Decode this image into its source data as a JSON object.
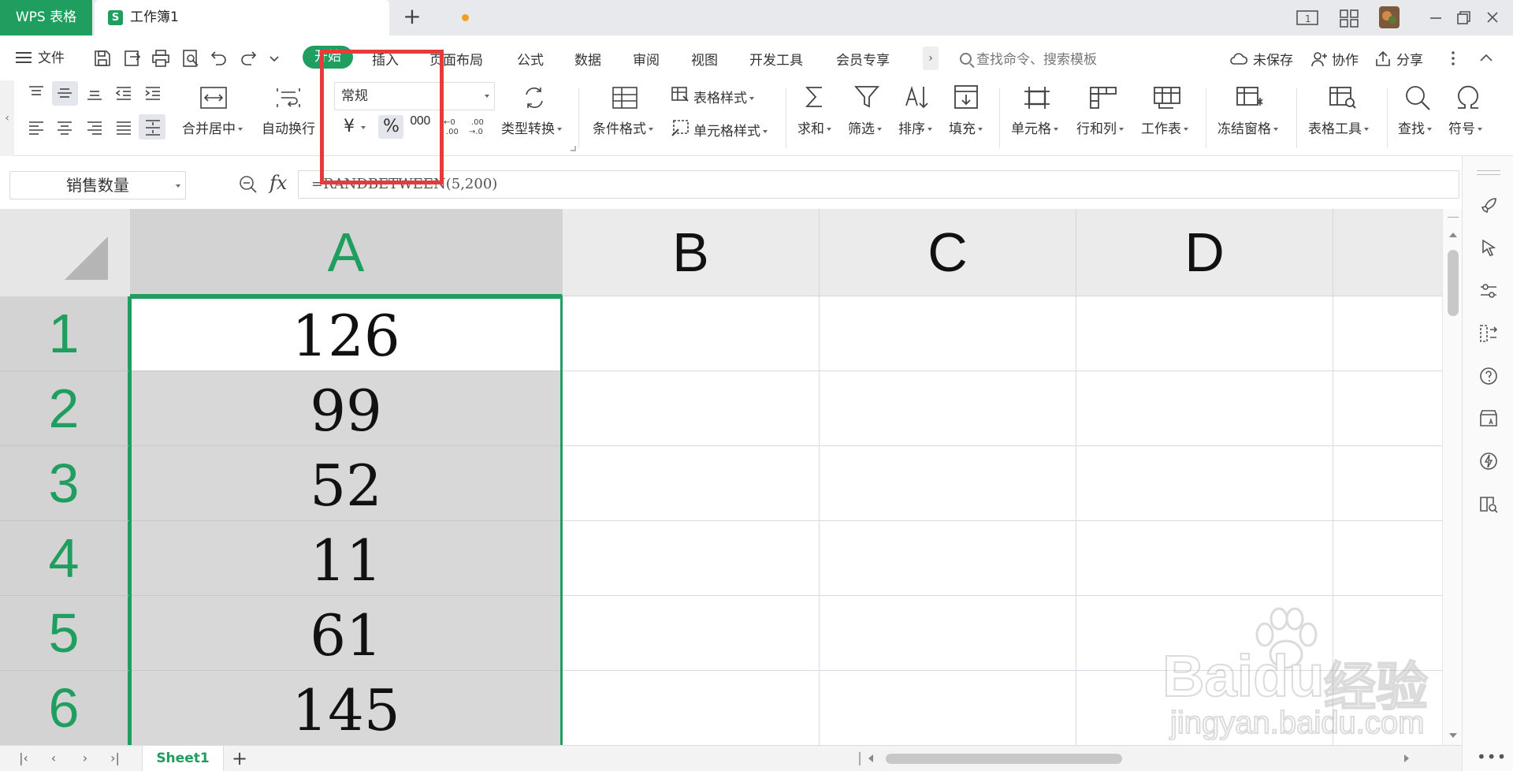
{
  "titlebar": {
    "app_tab": "WPS 表格",
    "doc_tab_icon": "S",
    "doc_title": "工作簿1",
    "new_tab": "+",
    "page_indicator": "1"
  },
  "menubar": {
    "file_label": "文件",
    "tabs": [
      "开始",
      "插入",
      "页面布局",
      "公式",
      "数据",
      "审阅",
      "视图",
      "开发工具",
      "会员专享"
    ],
    "more": "›",
    "search_placeholder": "查找命令、搜索模板",
    "unsaved": "未保存",
    "collaborate": "协作",
    "share": "分享"
  },
  "ribbon": {
    "merge_center": "合并居中",
    "auto_wrap": "自动换行",
    "number_format": "常规",
    "currency_symbol": "¥",
    "percent_symbol": "%",
    "thousands_symbol": "000",
    "type_convert": "类型转换",
    "conditional_format": "条件格式",
    "table_style": "表格样式",
    "cell_style": "单元格样式",
    "sum": "求和",
    "filter": "筛选",
    "sort": "排序",
    "fill": "填充",
    "cell": "单元格",
    "row_col": "行和列",
    "worksheet": "工作表",
    "freeze": "冻结窗格",
    "table_tools": "表格工具",
    "find": "查找",
    "symbol": "符号"
  },
  "formula_bar": {
    "name_box": "销售数量",
    "fx": "fx",
    "formula": "=RANDBETWEEN(5,200)"
  },
  "grid": {
    "columns": [
      "A",
      "B",
      "C",
      "D"
    ],
    "rows": [
      "1",
      "2",
      "3",
      "4",
      "5",
      "6"
    ],
    "column_a_values": [
      "126",
      "99",
      "52",
      "11",
      "61",
      "145"
    ]
  },
  "sheetbar": {
    "sheet_name": "Sheet1",
    "add": "+"
  },
  "colors": {
    "accent": "#1f9e5f",
    "highlight": "#e73a3a"
  },
  "watermark": {
    "brand": "Baidu",
    "cn": "经验",
    "url": "jingyan.baidu.com"
  }
}
